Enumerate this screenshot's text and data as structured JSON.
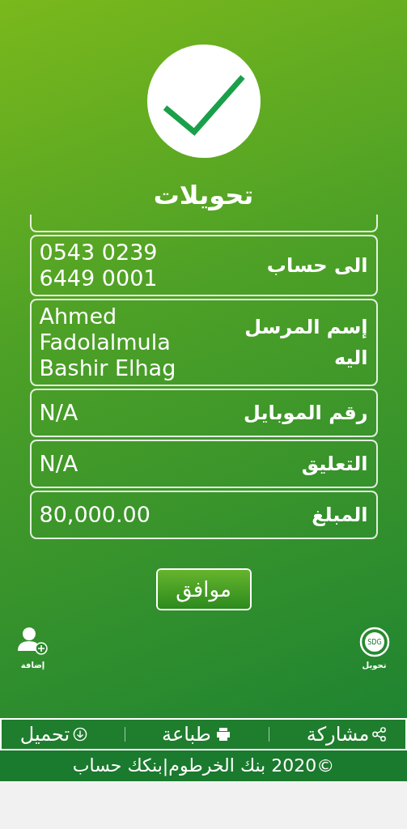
{
  "title": "تحويلات",
  "details": [
    {
      "label": "الى حساب",
      "value": "0543 0239\n6449 0001"
    },
    {
      "label": "إسم المرسل اليه",
      "value": "Ahmed\nFadolalmula\nBashir Elhag"
    },
    {
      "label": "رقم الموبايل",
      "value": "N/A"
    },
    {
      "label": "التعليق",
      "value": "N/A"
    },
    {
      "label": "المبلغ",
      "value": "80,000.00"
    }
  ],
  "ok_button": "موافق",
  "shortcuts": [
    {
      "kind": "transfer",
      "label": "تحويل",
      "badge": "SDG"
    },
    {
      "kind": "add",
      "label": "إضافة"
    }
  ],
  "actions": [
    {
      "kind": "share",
      "label": "مشاركة"
    },
    {
      "kind": "print",
      "label": "طباعة"
    },
    {
      "kind": "download",
      "label": "تحميل"
    }
  ],
  "footer": "©2020 بنك الخرطوم|بنكك حساب"
}
